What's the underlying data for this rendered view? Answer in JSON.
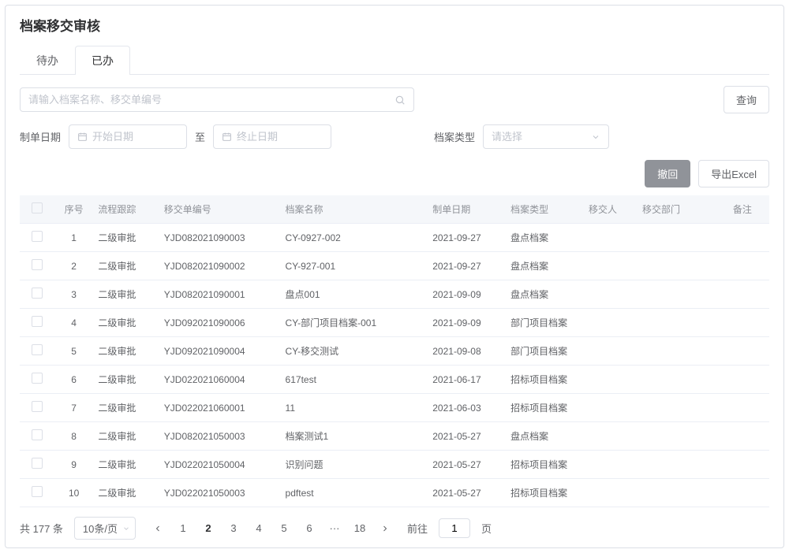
{
  "title": "档案移交审核",
  "tabs": [
    {
      "label": "待办",
      "active": false
    },
    {
      "label": "已办",
      "active": true
    }
  ],
  "search": {
    "placeholder": "请输入档案名称、移交单编号",
    "query_label": "查询"
  },
  "filters": {
    "date_label": "制单日期",
    "start_placeholder": "开始日期",
    "to_label": "至",
    "end_placeholder": "终止日期",
    "type_label": "档案类型",
    "type_placeholder": "请选择"
  },
  "actions": {
    "revoke_label": "撤回",
    "export_label": "导出Excel"
  },
  "table": {
    "headers": {
      "seq": "序号",
      "flow": "流程跟踪",
      "code": "移交单编号",
      "name": "档案名称",
      "date": "制单日期",
      "type": "档案类型",
      "person": "移交人",
      "dept": "移交部门",
      "remark": "备注"
    },
    "rows": [
      {
        "seq": "1",
        "flow": "二级审批",
        "code": "YJD082021090003",
        "name": "CY-0927-002",
        "date": "2021-09-27",
        "type": "盘点档案",
        "person": "",
        "dept": "",
        "remark": ""
      },
      {
        "seq": "2",
        "flow": "二级审批",
        "code": "YJD082021090002",
        "name": "CY-927-001",
        "date": "2021-09-27",
        "type": "盘点档案",
        "person": "",
        "dept": "",
        "remark": ""
      },
      {
        "seq": "3",
        "flow": "二级审批",
        "code": "YJD082021090001",
        "name": "盘点001",
        "date": "2021-09-09",
        "type": "盘点档案",
        "person": "",
        "dept": "",
        "remark": ""
      },
      {
        "seq": "4",
        "flow": "二级审批",
        "code": "YJD092021090006",
        "name": "CY-部门项目档案-001",
        "date": "2021-09-09",
        "type": "部门项目档案",
        "person": "",
        "dept": "",
        "remark": ""
      },
      {
        "seq": "5",
        "flow": "二级审批",
        "code": "YJD092021090004",
        "name": "CY-移交测试",
        "date": "2021-09-08",
        "type": "部门项目档案",
        "person": "",
        "dept": "",
        "remark": ""
      },
      {
        "seq": "6",
        "flow": "二级审批",
        "code": "YJD022021060004",
        "name": "617test",
        "date": "2021-06-17",
        "type": "招标项目档案",
        "person": "",
        "dept": "",
        "remark": ""
      },
      {
        "seq": "7",
        "flow": "二级审批",
        "code": "YJD022021060001",
        "name": "11",
        "date": "2021-06-03",
        "type": "招标项目档案",
        "person": "",
        "dept": "",
        "remark": ""
      },
      {
        "seq": "8",
        "flow": "二级审批",
        "code": "YJD082021050003",
        "name": "档案测试1",
        "date": "2021-05-27",
        "type": "盘点档案",
        "person": "",
        "dept": "",
        "remark": ""
      },
      {
        "seq": "9",
        "flow": "二级审批",
        "code": "YJD022021050004",
        "name": "识别问题",
        "date": "2021-05-27",
        "type": "招标项目档案",
        "person": "",
        "dept": "",
        "remark": ""
      },
      {
        "seq": "10",
        "flow": "二级审批",
        "code": "YJD022021050003",
        "name": "pdftest",
        "date": "2021-05-27",
        "type": "招标项目档案",
        "person": "",
        "dept": "",
        "remark": ""
      }
    ]
  },
  "pagination": {
    "total_label": "共 177 条",
    "size_label": "10条/页",
    "pages": [
      "1",
      "2",
      "3",
      "4",
      "5",
      "6",
      "···",
      "18"
    ],
    "current": "2",
    "goto_prefix": "前往",
    "goto_value": "1",
    "goto_suffix": "页"
  }
}
